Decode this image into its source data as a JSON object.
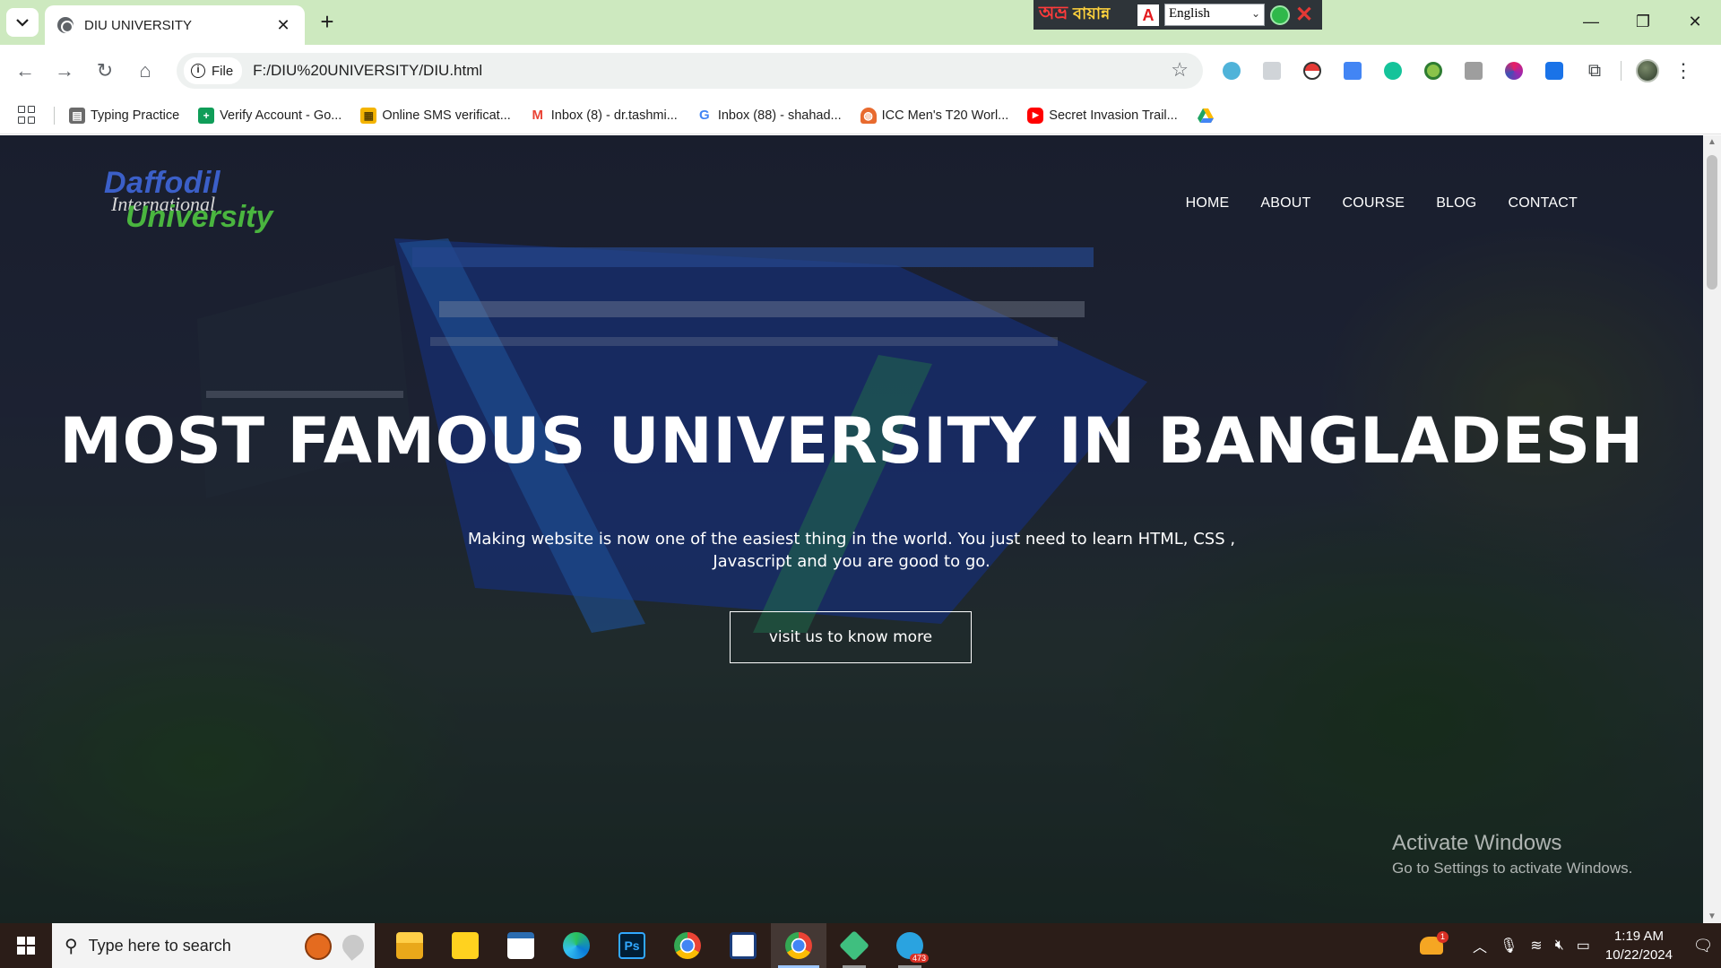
{
  "browser": {
    "tab": {
      "title": "DIU UNIVERSITY",
      "close": "✕"
    },
    "new_tab": "+",
    "bangla_bar": {
      "logo": "অভ্র",
      "name": "বায়ান্ন",
      "pdf": "A",
      "language": "English"
    },
    "window_controls": {
      "minimize": "—",
      "restore": "❐",
      "close": "✕"
    },
    "address": {
      "scheme_chip": "File",
      "url": "F:/DIU%20UNIVERSITY/DIU.html"
    },
    "bookmarks": [
      {
        "label": "Typing Practice",
        "icon": "typing-practice-icon",
        "color": "#6b6b6b"
      },
      {
        "label": "Verify Account - Go...",
        "icon": "google-sheets-plus-icon",
        "color": "#0f9d58"
      },
      {
        "label": "Online SMS verificat...",
        "icon": "sms-grid-icon",
        "color": "#f4b400"
      },
      {
        "label": "Inbox (8) - dr.tashmi...",
        "icon": "gmail-icon",
        "color": "#ea4335"
      },
      {
        "label": "Inbox (88) - shahad...",
        "icon": "google-g-icon",
        "color": "#4285f4"
      },
      {
        "label": "ICC Men's T20 Worl...",
        "icon": "icc-icon",
        "color": "#e86a2e"
      },
      {
        "label": "Secret Invasion Trail...",
        "icon": "youtube-icon",
        "color": "#ff0000"
      },
      {
        "label": "",
        "icon": "google-drive-icon",
        "color": "#1fa463"
      }
    ]
  },
  "site": {
    "logo": {
      "line1": "Daffodil",
      "line2": "International",
      "line3": "University"
    },
    "nav": [
      "HOME",
      "ABOUT",
      "COURSE",
      "BLOG",
      "CONTACT"
    ],
    "hero": {
      "title": "MOST FAMOUS UNIVERSITY IN BANGLADESH",
      "text": "Making website is now one of the easiest thing in the world. You just need to learn HTML, CSS , Javascript and you are good to go.",
      "button": "visit us to know more"
    }
  },
  "watermark": {
    "title": "Activate Windows",
    "subtitle": "Go to Settings to activate Windows."
  },
  "taskbar": {
    "search_placeholder": "Type here to search",
    "telegram_badge": "473",
    "weather_badge": "1",
    "time": "1:19 AM",
    "date": "10/22/2024"
  },
  "colors": {
    "tabstrip": "#cde9bf",
    "logo_blue": "#3b5fc8",
    "logo_green": "#4ab53f",
    "taskbar": "#2b1d18"
  }
}
